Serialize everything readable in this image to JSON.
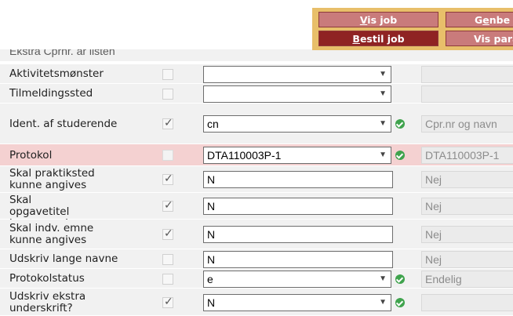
{
  "header": {
    "buttons": {
      "vis_job": "Vis job",
      "genbe": "Genbe",
      "bestil_job": "Bestil job",
      "vis_para": "Vis para"
    }
  },
  "form": {
    "scrolled_row_label": "Ekstra Cprnr. ar listen",
    "rows": [
      {
        "label": "Aktivitetsmønster",
        "checked": false,
        "value": "",
        "kind": "select",
        "valid": false,
        "readonly": ""
      },
      {
        "label": "Tilmeldingssted",
        "checked": false,
        "value": "",
        "kind": "select",
        "valid": false,
        "readonly": ""
      },
      {
        "label": "Ident. af studerende",
        "checked": true,
        "value": "cn",
        "kind": "select",
        "valid": true,
        "readonly": "Cpr.nr og navn"
      },
      {
        "label": "Protokol",
        "checked": false,
        "value": "DTA110003P-1",
        "kind": "select",
        "valid": true,
        "readonly": "DTA110003P-1",
        "highlighted": true
      },
      {
        "label": "Skal praktiksted kunne angives",
        "checked": true,
        "value": "N",
        "kind": "text",
        "valid": false,
        "readonly": "Nej"
      },
      {
        "label": "Skal opgavetitel kunne angives",
        "checked": true,
        "value": "N",
        "kind": "text",
        "valid": false,
        "readonly": "Nej"
      },
      {
        "label": "Skal indv. emne kunne angives",
        "checked": true,
        "value": "N",
        "kind": "text",
        "valid": false,
        "readonly": "Nej"
      },
      {
        "label": "Udskriv lange navne",
        "checked": false,
        "value": "N",
        "kind": "text",
        "valid": false,
        "readonly": "Nej"
      },
      {
        "label": "Protokolstatus",
        "checked": false,
        "value": "e",
        "kind": "select",
        "valid": true,
        "readonly": "Endelig"
      },
      {
        "label": "Udskriv ekstra underskrift?",
        "checked": true,
        "value": "N",
        "kind": "select",
        "valid": true,
        "readonly": ""
      }
    ]
  },
  "icons": {
    "select_arrow": "dropdown-arrow-icon",
    "valid": "check-circle-icon",
    "checkbox": "checkbox-icon"
  },
  "colors": {
    "button_light": "#c97b7b",
    "button_dark": "#8f2323",
    "button_panel": "#e8bf6a",
    "row_bg": "#f1f1f1",
    "row_highlight": "#f4d1d1",
    "valid_green": "#3fa34d"
  }
}
